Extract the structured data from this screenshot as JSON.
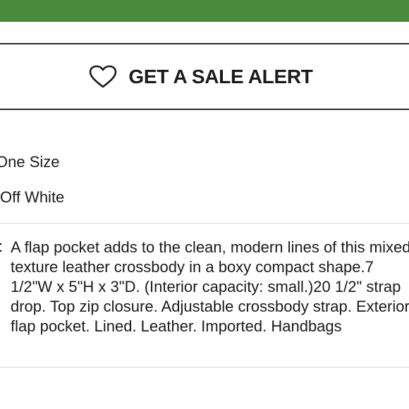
{
  "colors": {
    "brand_green": "#4a8a3c",
    "text": "#1a1a1a",
    "divider": "#d6d6d6"
  },
  "sale_alert": {
    "label": "GET A SALE ALERT",
    "icon": "heart-outline-icon"
  },
  "details": {
    "size_value": "One Size",
    "color_value": "Off White",
    "description_prefix": ":",
    "description": "A flap pocket adds to the clean, modern lines of this mixed-texture leather crossbody in a boxy compact shape.7 1/2\"W x 5\"H x 3\"D. (Interior capacity: small.)20 1/2\" strap drop. Top zip closure. Adjustable crossbody strap. Exterior flap pocket. Lined. Leather. Imported. Handbags"
  }
}
